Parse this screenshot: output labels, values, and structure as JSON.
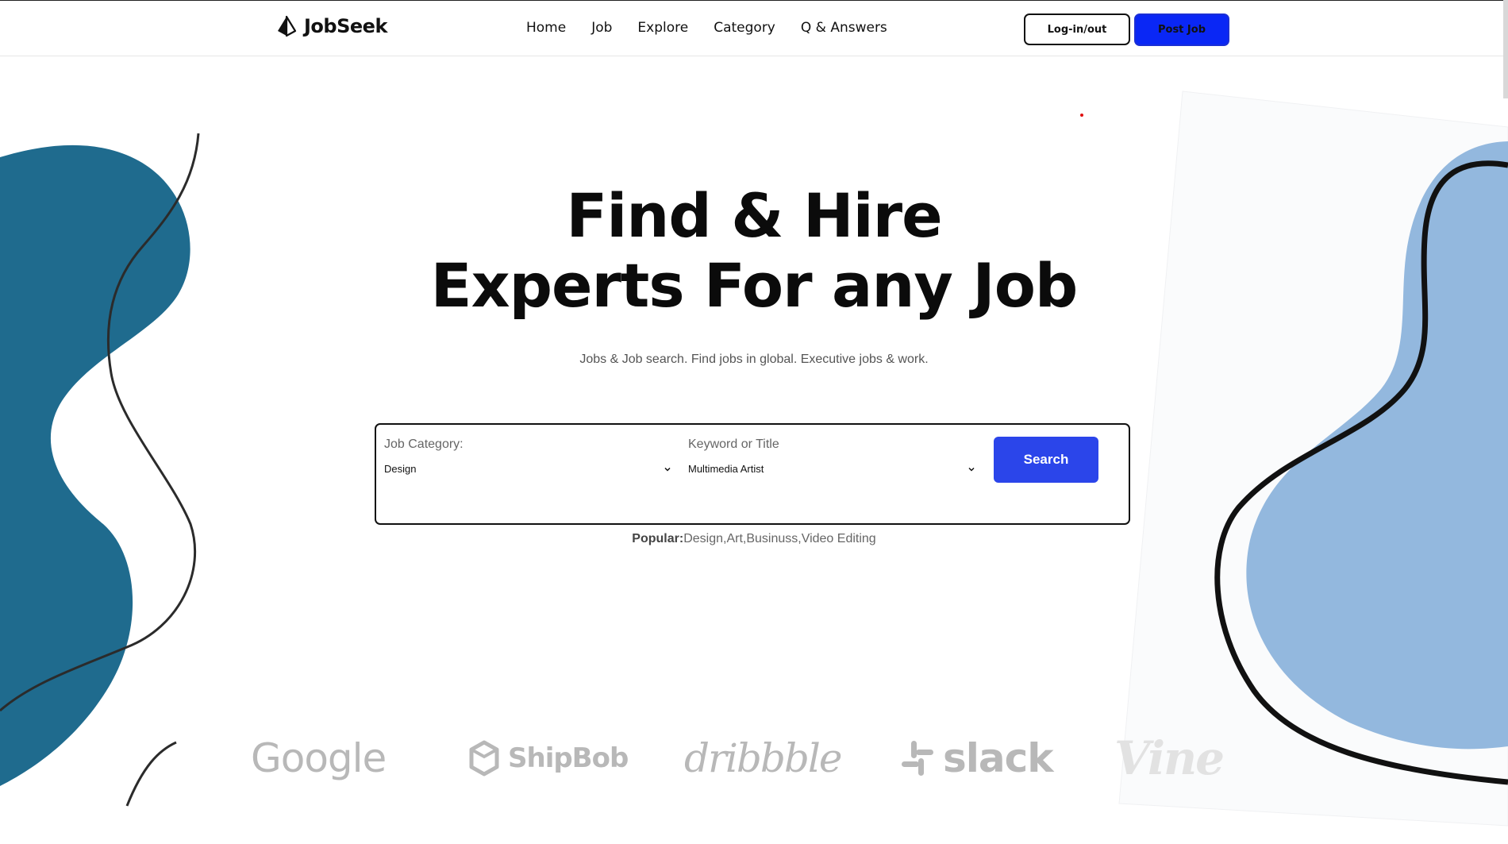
{
  "header": {
    "logo_text": "JobSeek",
    "nav": [
      "Home",
      "Job",
      "Explore",
      "Category",
      "Q & Answers"
    ],
    "login_label": "Log-in/out",
    "post_job_label": "Post Job"
  },
  "hero": {
    "title_line1": "Find & Hire",
    "title_line2": "Experts For any Job",
    "subtitle": "Jobs & Job search. Find jobs in global. Executive jobs & work."
  },
  "search": {
    "category_label": "Job Category:",
    "category_value": "Design",
    "keyword_label": "Keyword or Title",
    "keyword_value": "Multimedia Artist",
    "button_label": "Search"
  },
  "popular": {
    "label": "Popular:",
    "items": "Design,Art,Businuss,Video Editing"
  },
  "brands": [
    "Google",
    "ShipBob",
    "dribbble",
    "slack",
    "Vine"
  ],
  "colors": {
    "primary_blue": "#0a27f5",
    "search_blue": "#2b45ea",
    "blob_dark": "#1f6b8e",
    "blob_light": "#93b8de"
  }
}
